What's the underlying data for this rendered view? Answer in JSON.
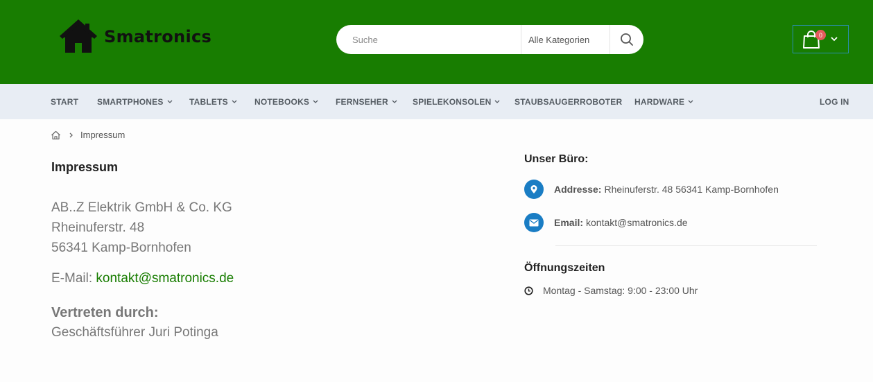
{
  "header": {
    "logo_text": "Smatronics",
    "search": {
      "placeholder": "Suche",
      "category": "Alle Kategorien"
    },
    "cart": {
      "count": "0"
    },
    "colors": {
      "header_bg": "#187d01",
      "cart_badge": "#e35b5b",
      "accent_blue": "#1a7dc4"
    }
  },
  "nav": {
    "items": [
      {
        "label": "START",
        "has_dropdown": false
      },
      {
        "label": "SMARTPHONES",
        "has_dropdown": true
      },
      {
        "label": "TABLETS",
        "has_dropdown": true
      },
      {
        "label": "NOTEBOOKS",
        "has_dropdown": true
      },
      {
        "label": "FERNSEHER",
        "has_dropdown": true
      },
      {
        "label": "SPIELEKONSOLEN",
        "has_dropdown": true
      },
      {
        "label": "STAUBSAUGERROBOTER",
        "has_dropdown": false
      },
      {
        "label": "HARDWARE",
        "has_dropdown": true
      }
    ],
    "login": "LOG IN"
  },
  "breadcrumb": {
    "current": "Impressum"
  },
  "impressum": {
    "title": "Impressum",
    "address_lines": [
      "AB..Z Elektrik GmbH & Co. KG",
      "Rheinuferstr. 48",
      "56341 Kamp-Bornhofen"
    ],
    "email_label": "E-Mail:",
    "email": "kontakt@smatronics.de",
    "represented_title": "Vertreten durch:",
    "represented_name": "Geschäftsführer Juri Potinga"
  },
  "office": {
    "title": "Unser Büro:",
    "address_label": "Addresse:",
    "address_value": "Rheinuferstr. 48 56341 Kamp-Bornhofen",
    "email_label": "Email:",
    "email_value": "kontakt@smatronics.de"
  },
  "hours": {
    "title": "Öffnungszeiten",
    "text": "Montag - Samstag: 9:00 - 23:00 Uhr"
  }
}
